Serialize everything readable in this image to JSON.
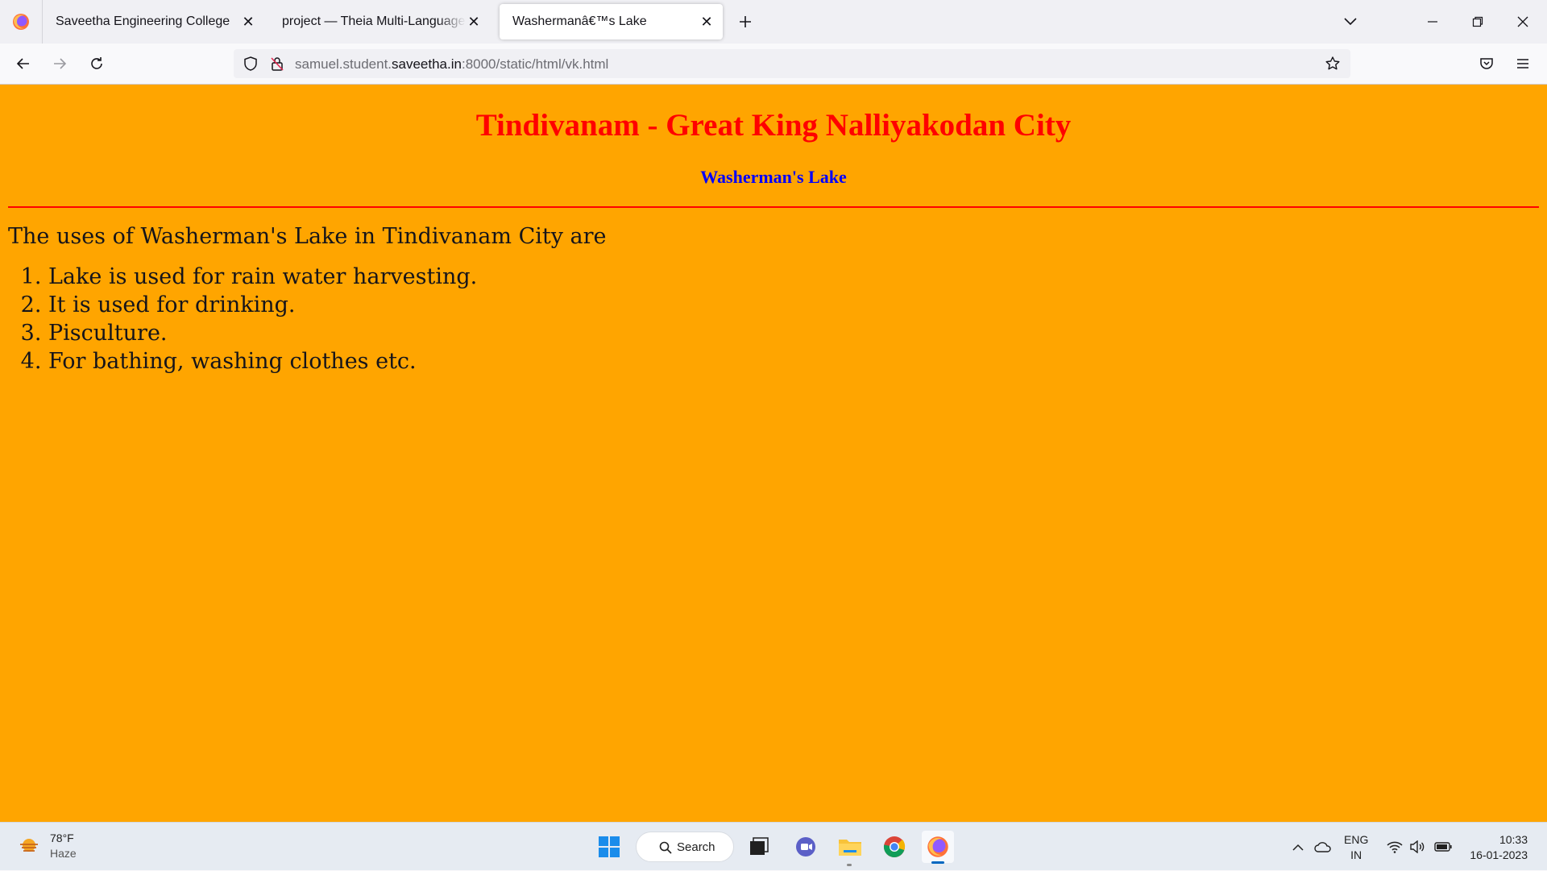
{
  "browser": {
    "tabs": [
      {
        "title": "Saveetha Engineering College",
        "active": false
      },
      {
        "title": "project — Theia Multi-Language Ex",
        "active": false
      },
      {
        "title": "Washermanâ€™s Lake",
        "active": true
      }
    ],
    "url": {
      "prefix": "samuel.student.",
      "host": "saveetha.in",
      "suffix": ":8000/static/html/vk.html"
    }
  },
  "page": {
    "heading": "Tindivanam - Great King Nalliyakodan City",
    "subheading": "Washerman's Lake",
    "intro": "The uses of Washerman's Lake in Tindivanam City are",
    "uses": [
      "Lake is used for rain water harvesting.",
      "It is used for drinking.",
      "Pisculture.",
      "For bathing, washing clothes etc."
    ],
    "colors": {
      "background": "#ffa500",
      "heading": "#ff0000",
      "subheading": "#0000ff",
      "rule": "#ff0000"
    }
  },
  "taskbar": {
    "weather": {
      "temp": "78°F",
      "condition": "Haze"
    },
    "search_label": "Search",
    "language": {
      "line1": "ENG",
      "line2": "IN"
    },
    "clock": {
      "time": "10:33",
      "date": "16-01-2023"
    }
  }
}
